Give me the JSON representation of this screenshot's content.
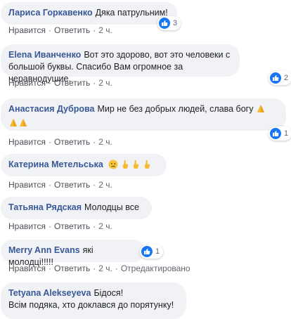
{
  "actions": {
    "like": "Нравится",
    "reply": "Ответить",
    "dot": "·",
    "edited": "Отредактировано"
  },
  "icons": {
    "like_reaction": "like-icon",
    "pray": "praying-hands-emoji",
    "sad": "sad-face-emoji",
    "finger": "crossed-fingers-emoji"
  },
  "colors": {
    "author": "#385898",
    "bubble": "#f0f2f5",
    "like": "#1877f2",
    "meta": "#606770"
  },
  "comments": [
    {
      "author": "Лариса Горкавенко",
      "text": "Дяка патрульним!",
      "time": "2 ч.",
      "reactions": "3"
    },
    {
      "author": "Elena Иванченко",
      "text": "Вот это здорово, вот это человеки с большой буквы. Спасибо Вам огромное за неравнодушие.",
      "time": "2 ч.",
      "reactions": "2"
    },
    {
      "author": "Анастасия Дуброва",
      "text": "Мир не без добрых людей, слава богу",
      "time": "2 ч.",
      "reactions": "1"
    },
    {
      "author": "Катерина Метельська",
      "text": "",
      "time": "2 ч."
    },
    {
      "author": "Татьяна Рядская",
      "text": "Молодцы все",
      "time": "2 ч."
    },
    {
      "author": "Merry Ann Evans",
      "text": "які молодці!!!!!",
      "time": "2 ч.",
      "reactions": "1"
    },
    {
      "author": "Tetyana Alekseyeva",
      "text": "Бідося!",
      "text2": "Всім подяка, хто доклався до порятунку!"
    }
  ]
}
